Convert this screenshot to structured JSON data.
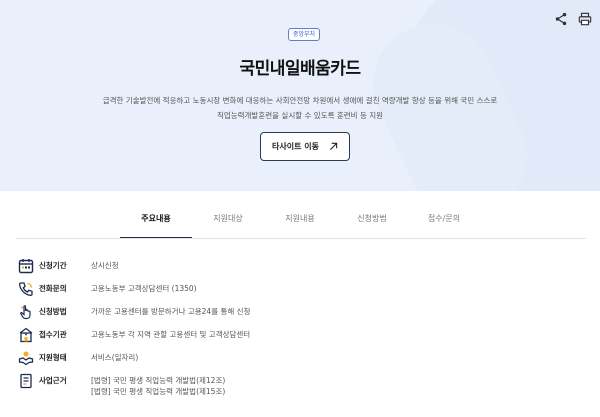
{
  "hero": {
    "badge": "중앙부처",
    "title": "국민내일배움카드",
    "desc_line1": "급격한 기술발전에 적응하고 노동시장 변화에 대응하는 사회안전망 차원에서 생애에 걸친 역량개발 향상 등을 위해 국민 스스로",
    "desc_line2": "직업능력개발훈련을 실시할 수 있도록 훈련비 등 지원",
    "site_button": "타사이트 이동"
  },
  "top_icons": [
    "share-icon",
    "print-icon"
  ],
  "tabs": [
    {
      "label": "주요내용",
      "active": true
    },
    {
      "label": "지원대상",
      "active": false
    },
    {
      "label": "지원내용",
      "active": false
    },
    {
      "label": "신청방법",
      "active": false
    },
    {
      "label": "접수/문의",
      "active": false
    }
  ],
  "info": [
    {
      "label": "신청기간",
      "value": "상시신청",
      "icon": "calendar-icon"
    },
    {
      "label": "전화문의",
      "value": "고용노동부 고객상담센터 (1350)",
      "icon": "phone-icon"
    },
    {
      "label": "신청방법",
      "value": "가까운 고용센터를 방문하거나 고용24를 통해 신청",
      "icon": "pointer-icon"
    },
    {
      "label": "접수기관",
      "value": "고용노동부 각 지역 관할 고용센터 및 고객상담센터",
      "icon": "building-icon"
    },
    {
      "label": "지원형태",
      "value": "서비스(일자리)",
      "icon": "handshake-icon"
    },
    {
      "label": "사업근거",
      "value_line1": "[법령] 국민 평생 직업능력 개발법(제12조)",
      "value_line2": "[법령] 국민 평생 직업능력 개발법(제15조)",
      "icon": "document-icon"
    }
  ],
  "colors": {
    "hero_bg": "#eaf0fb",
    "accent": "#3a63c8",
    "navy": "#1d2b4f"
  }
}
